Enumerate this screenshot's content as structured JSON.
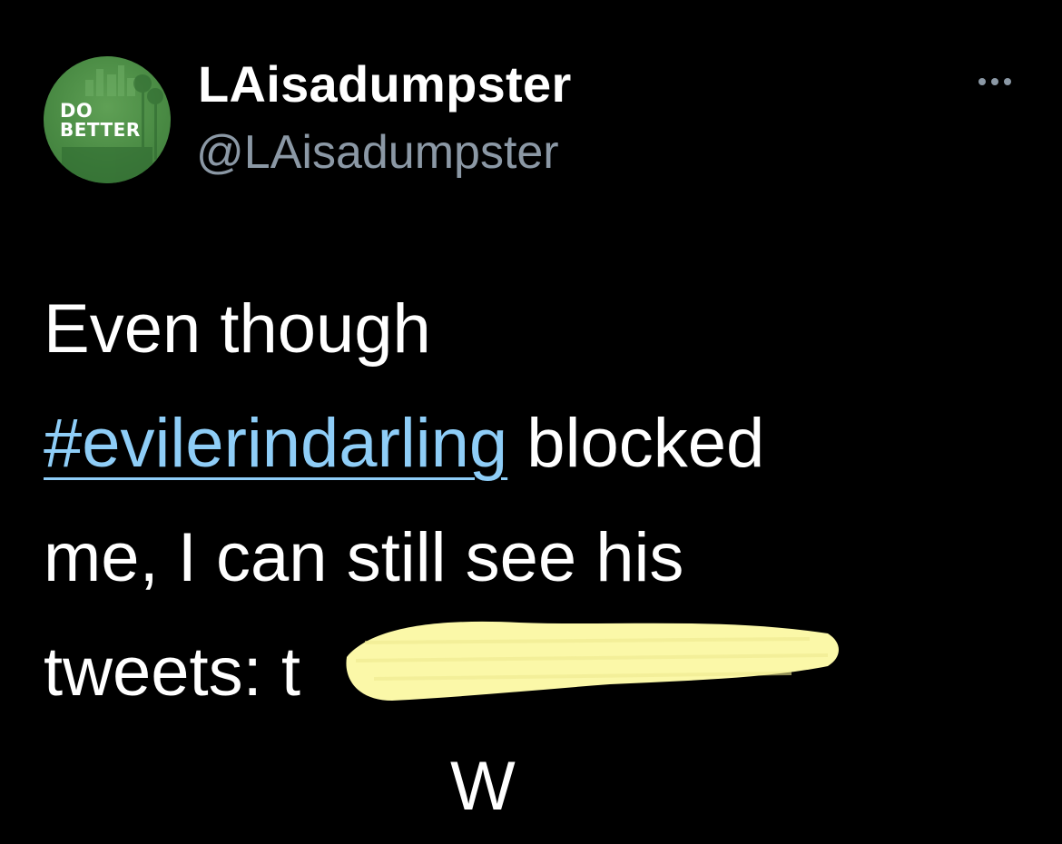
{
  "tweet": {
    "avatar": {
      "line1": "DO",
      "line2": "BETTER",
      "icon": "la-skyline-avatar"
    },
    "display_name": "LAisadumpster",
    "handle": "@LAisadumpster",
    "more_icon": "more-dots-icon",
    "body": {
      "line1": "Even though",
      "hashtag": "#evilerindarling",
      "line2_rest": " blocked",
      "line3": "me, I can still see his",
      "line4_visible": "tweets: t",
      "line5_visible": "W"
    },
    "colors": {
      "background": "#000000",
      "name": "#ffffff",
      "handle": "#8b98a5",
      "link": "#8ecdf7",
      "redaction": "#fbf8a8",
      "avatar_green": "#4a8b44"
    }
  }
}
